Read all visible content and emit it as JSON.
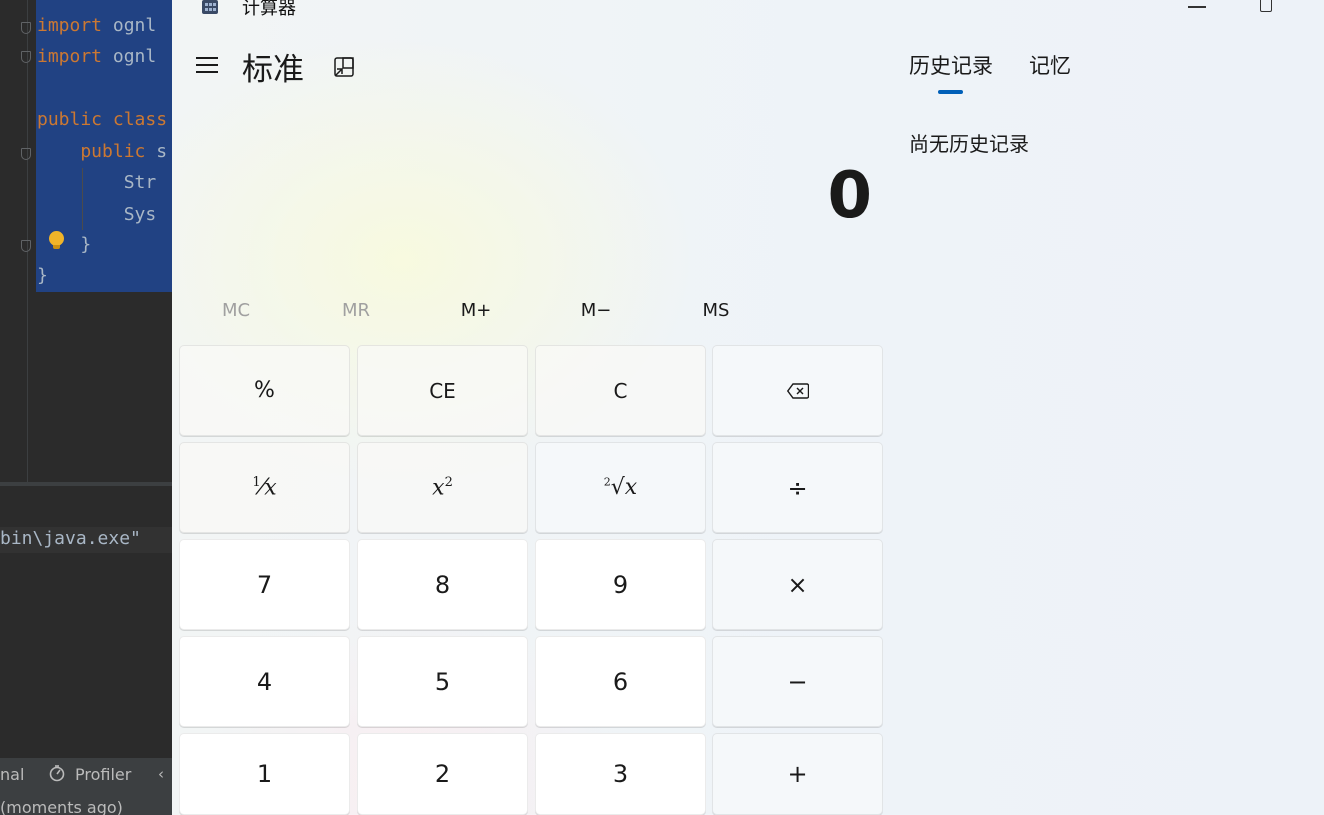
{
  "ide": {
    "code_lines": [
      {
        "kw": "import",
        "rest": " ognl"
      },
      {
        "kw": "import",
        "rest": " ognl"
      },
      {
        "kw": "public class",
        "rest": ""
      },
      {
        "kw": "    public",
        "rest": " s"
      },
      {
        "kw": "",
        "rest": "        Str"
      },
      {
        "kw": "",
        "rest": "        Sys"
      },
      {
        "kw": "",
        "rest": "    }"
      },
      {
        "kw": "",
        "rest": "}"
      }
    ],
    "console_text": "bin\\java.exe\"",
    "status_terminal": "nal",
    "status_profiler": "Profiler",
    "status_sub": "(moments ago)"
  },
  "calculator": {
    "window_title": "计算器",
    "mode_title": "标准",
    "display_value": "0",
    "memory_buttons": [
      {
        "label": "MC",
        "enabled": false
      },
      {
        "label": "MR",
        "enabled": false
      },
      {
        "label": "M+",
        "enabled": true
      },
      {
        "label": "M−",
        "enabled": true
      },
      {
        "label": "MS",
        "enabled": true
      }
    ],
    "keys": {
      "percent": "%",
      "ce": "CE",
      "c": "C",
      "divide": "÷",
      "seven": "7",
      "eight": "8",
      "nine": "9",
      "multiply": "×",
      "four": "4",
      "five": "5",
      "six": "6",
      "minus": "−",
      "one": "1",
      "two": "2",
      "three": "3",
      "plus": "+"
    },
    "tabs": {
      "history": "历史记录",
      "memory": "记忆"
    },
    "history_empty": "尚无历史记录",
    "accent_color": "#005fb8"
  }
}
